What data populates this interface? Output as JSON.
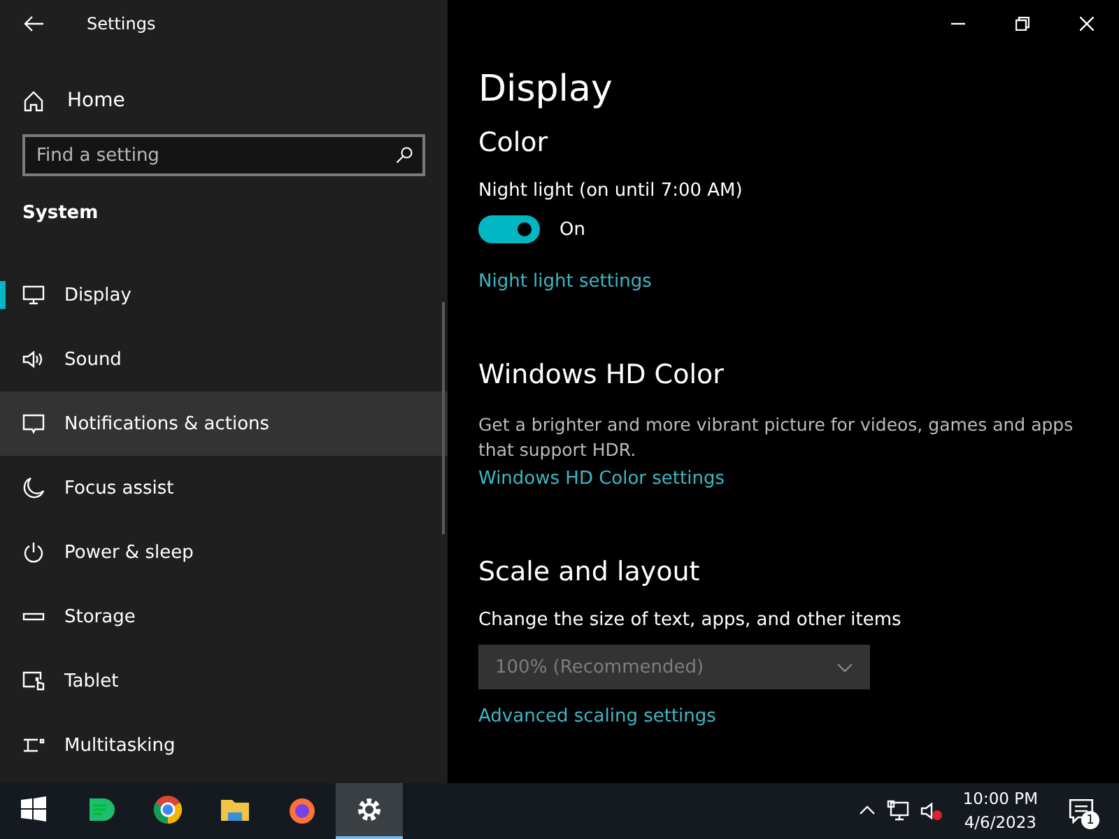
{
  "window": {
    "title": "Settings"
  },
  "sidebar": {
    "home": "Home",
    "search": {
      "placeholder": "Find a setting"
    },
    "section": "System",
    "items": [
      {
        "label": "Display",
        "kind": "display",
        "selected": true,
        "highlighted": false
      },
      {
        "label": "Sound",
        "kind": "sound",
        "selected": false,
        "highlighted": false
      },
      {
        "label": "Notifications & actions",
        "kind": "notifications",
        "selected": false,
        "highlighted": true
      },
      {
        "label": "Focus assist",
        "kind": "moon",
        "selected": false,
        "highlighted": false
      },
      {
        "label": "Power & sleep",
        "kind": "power",
        "selected": false,
        "highlighted": false
      },
      {
        "label": "Storage",
        "kind": "storage",
        "selected": false,
        "highlighted": false
      },
      {
        "label": "Tablet",
        "kind": "tablet",
        "selected": false,
        "highlighted": false
      },
      {
        "label": "Multitasking",
        "kind": "multitasking",
        "selected": false,
        "highlighted": false
      }
    ]
  },
  "content": {
    "title": "Display",
    "sections": [
      {
        "heading": "Color",
        "label": "Night light (on until 7:00 AM)",
        "toggle": {
          "on": true,
          "label": "On"
        },
        "link": "Night light settings"
      },
      {
        "heading": "Windows HD Color",
        "description": "Get a brighter and more vibrant picture for videos, games and apps that support HDR.",
        "link": "Windows HD Color settings"
      },
      {
        "heading": "Scale and layout",
        "label": "Change the size of text, apps, and other items",
        "dropdown": {
          "value": "100% (Recommended)",
          "disabled": true
        },
        "link": "Advanced scaling settings"
      }
    ]
  },
  "taskbar": {
    "apps": [
      {
        "kind": "chat",
        "active": false
      },
      {
        "kind": "chrome",
        "active": false
      },
      {
        "kind": "folder",
        "active": false
      },
      {
        "kind": "firefox",
        "active": false
      },
      {
        "kind": "settings",
        "active": true
      }
    ],
    "time": "10:00 PM",
    "date": "4/6/2023",
    "notification_count": "1"
  }
}
